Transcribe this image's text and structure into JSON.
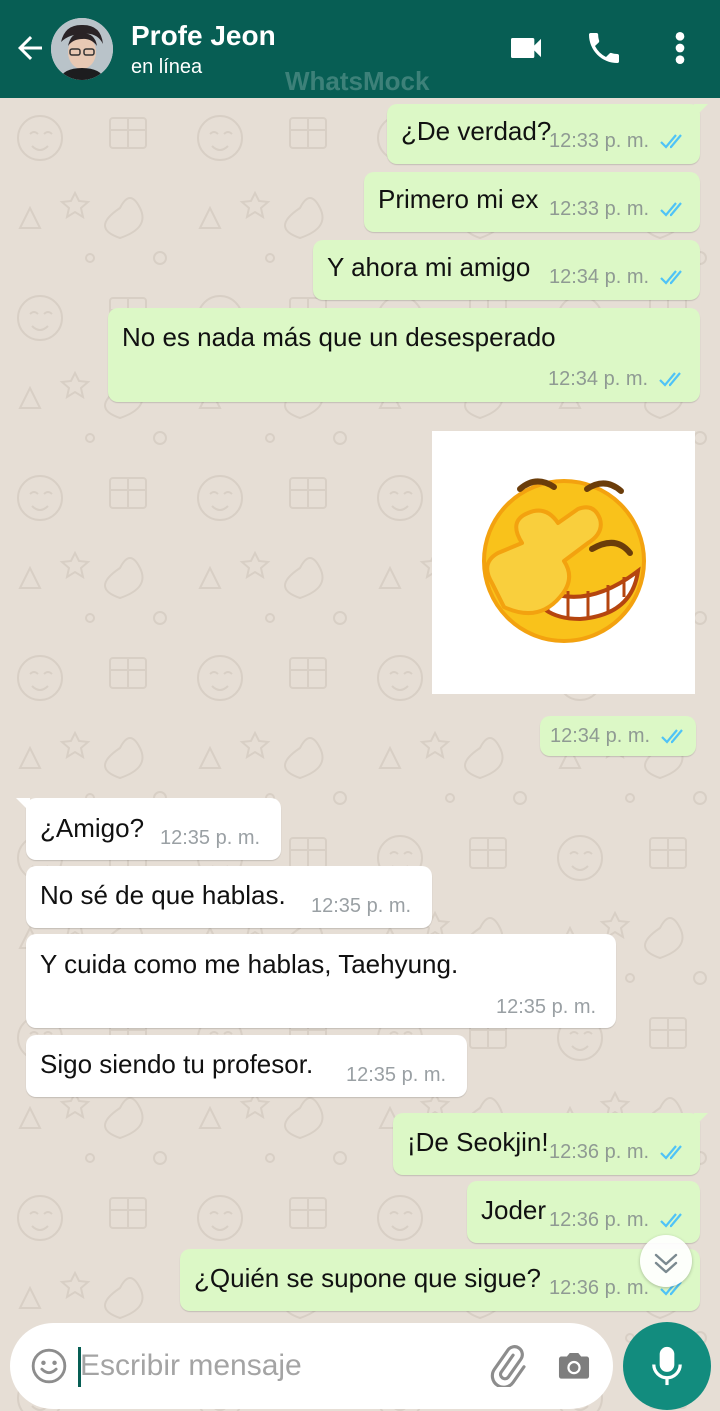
{
  "header": {
    "contact_name": "Profe Jeon",
    "status": "en línea",
    "watermark": "WhatsMock",
    "colors": {
      "bar": "#075e54",
      "accent": "#128c7e"
    }
  },
  "messages": [
    {
      "direction": "out",
      "text": "¿De verdad?",
      "time": "12:33 p. m.",
      "read": true
    },
    {
      "direction": "out",
      "text": "Primero mi ex",
      "time": "12:33 p. m.",
      "read": true
    },
    {
      "direction": "out",
      "text": "Y ahora mi amigo",
      "time": "12:34 p. m.",
      "read": true
    },
    {
      "direction": "out",
      "text": "No es nada más que un desesperado",
      "time": "12:34 p. m.",
      "read": true
    },
    {
      "direction": "out",
      "type": "sticker",
      "sticker": "facepalm-laughing-emoji",
      "time": "12:34 p. m.",
      "read": true
    },
    {
      "direction": "in",
      "text": "¿Amigo?",
      "time": "12:35 p. m."
    },
    {
      "direction": "in",
      "text": "No sé de que hablas.",
      "time": "12:35 p. m."
    },
    {
      "direction": "in",
      "text": "Y cuida como me hablas, Taehyung.",
      "time": "12:35 p. m."
    },
    {
      "direction": "in",
      "text": "Sigo siendo tu profesor.",
      "time": "12:35 p. m."
    },
    {
      "direction": "out",
      "text": "¡De Seokjin!",
      "time": "12:36 p. m.",
      "read": true
    },
    {
      "direction": "out",
      "text": "Joder",
      "time": "12:36 p. m.",
      "read": true
    },
    {
      "direction": "out",
      "text": "¿Quién se supone que sigue?",
      "time": "12:36 p. m.",
      "read": true
    }
  ],
  "composer": {
    "placeholder": "Escribir mensaje",
    "value": ""
  },
  "icons": [
    "back-arrow-icon",
    "video-call-icon",
    "phone-icon",
    "more-menu-icon",
    "read-ticks-icon",
    "scroll-down-icon",
    "emoji-icon",
    "attach-icon",
    "camera-icon",
    "mic-icon"
  ],
  "colors": {
    "outgoing_bubble": "#dcf8c6",
    "incoming_bubble": "#ffffff",
    "read_ticks": "#4fc3f7",
    "chat_bg": "#e6ded5"
  }
}
